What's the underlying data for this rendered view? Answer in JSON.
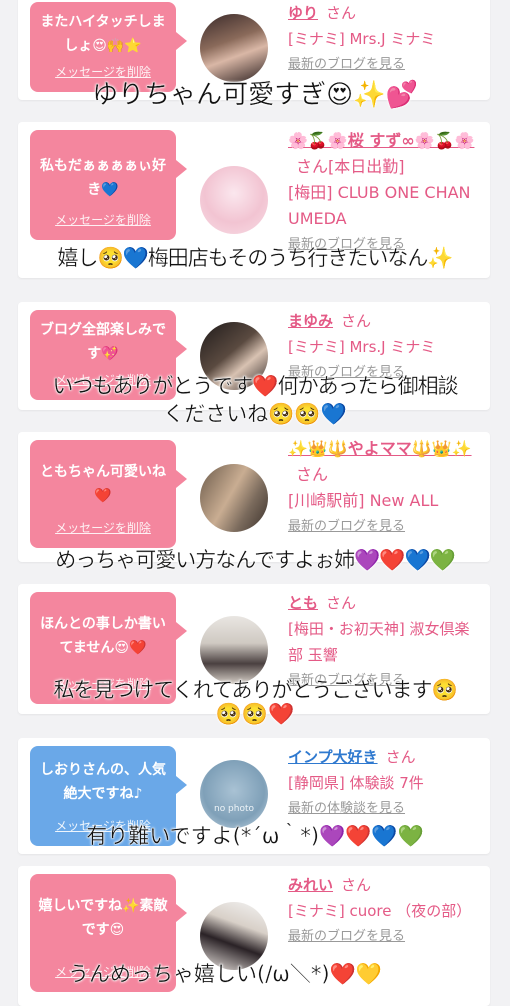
{
  "cards": [
    {
      "bubble_text": "またハイタッチしましょ😍🙌⭐",
      "delete_label": "メッセージを削除",
      "name": "ゆり",
      "san": "さん",
      "line2": "[ミナミ] Mrs.J ミナミ",
      "blog_link": "最新のブログを見る",
      "overlay": "ゆりちゃん可愛すぎ😍✨💕"
    },
    {
      "bubble_text": "私もだぁぁぁぁぃ好き💙",
      "delete_label": "メッセージを削除",
      "name": "🌸🍒🌸桜 すず∞🌸🍒🌸",
      "san": "さん[本日出勤]",
      "line2": "[梅田] CLUB ONE CHAN UMEDA",
      "blog_link": "最新のブログを見る",
      "overlay": "嬉し🥺💙梅田店もそのうち行きたいなん✨"
    },
    {
      "bubble_text": "ブログ全部楽しみです💖",
      "delete_label": "メッセージを削除",
      "name": "まゆみ",
      "san": "さん",
      "line2": "[ミナミ] Mrs.J ミナミ",
      "blog_link": "最新のブログを見る",
      "overlay_line1": "いつもありがとうです❤️何かあったら御相談",
      "overlay_line2": "くださいね🥺🥺💙"
    },
    {
      "bubble_text": "ともちゃん可愛いね❤️",
      "delete_label": "メッセージを削除",
      "name": "✨👑🔱やよママ🔱👑✨",
      "san": "さん",
      "line2": "[川崎駅前] New ALL",
      "blog_link": "最新のブログを見る",
      "overlay": "めっちゃ可愛い方なんですよぉ姉💜❤️💙💚"
    },
    {
      "bubble_text": "ほんとの事しか書いてません😍❤️",
      "delete_label": "メッセージを削除",
      "name": "とも",
      "san": "さん",
      "line2": "[梅田・お初天神] 淑女倶楽部 玉響",
      "blog_link": "最新のブログを見る",
      "overlay_line1": "私を見つけてくれてありがとうございます🥺",
      "overlay_line2": "🥺🥺❤️"
    },
    {
      "bubble_text": "しおりさんの、人気絶大ですね♪",
      "delete_label": "メッセージを削除",
      "name": "インプ大好き",
      "san": "さん",
      "line2": "[静岡県] 体験談 7件",
      "blog_link": "最新の体験談を見る",
      "avatar_text": "no photo",
      "overlay": "有り難いですよ(*´ω｀*)💜❤️💙💚"
    },
    {
      "bubble_text": "嬉しいですね✨素敵です😍",
      "delete_label": "メッセージを削除",
      "name": "みれい",
      "san": "さん",
      "line2": "[ミナミ] cuore （夜の部）",
      "blog_link": "最新のブログを見る",
      "overlay": "うんめっちゃ嬉しい(/ω＼*)❤️💛"
    }
  ],
  "colors": {
    "pink_bubble": "#f4869e",
    "blue_bubble": "#6aa8e8",
    "pink_text": "#e45a86",
    "blue_text": "#2f79cf"
  }
}
